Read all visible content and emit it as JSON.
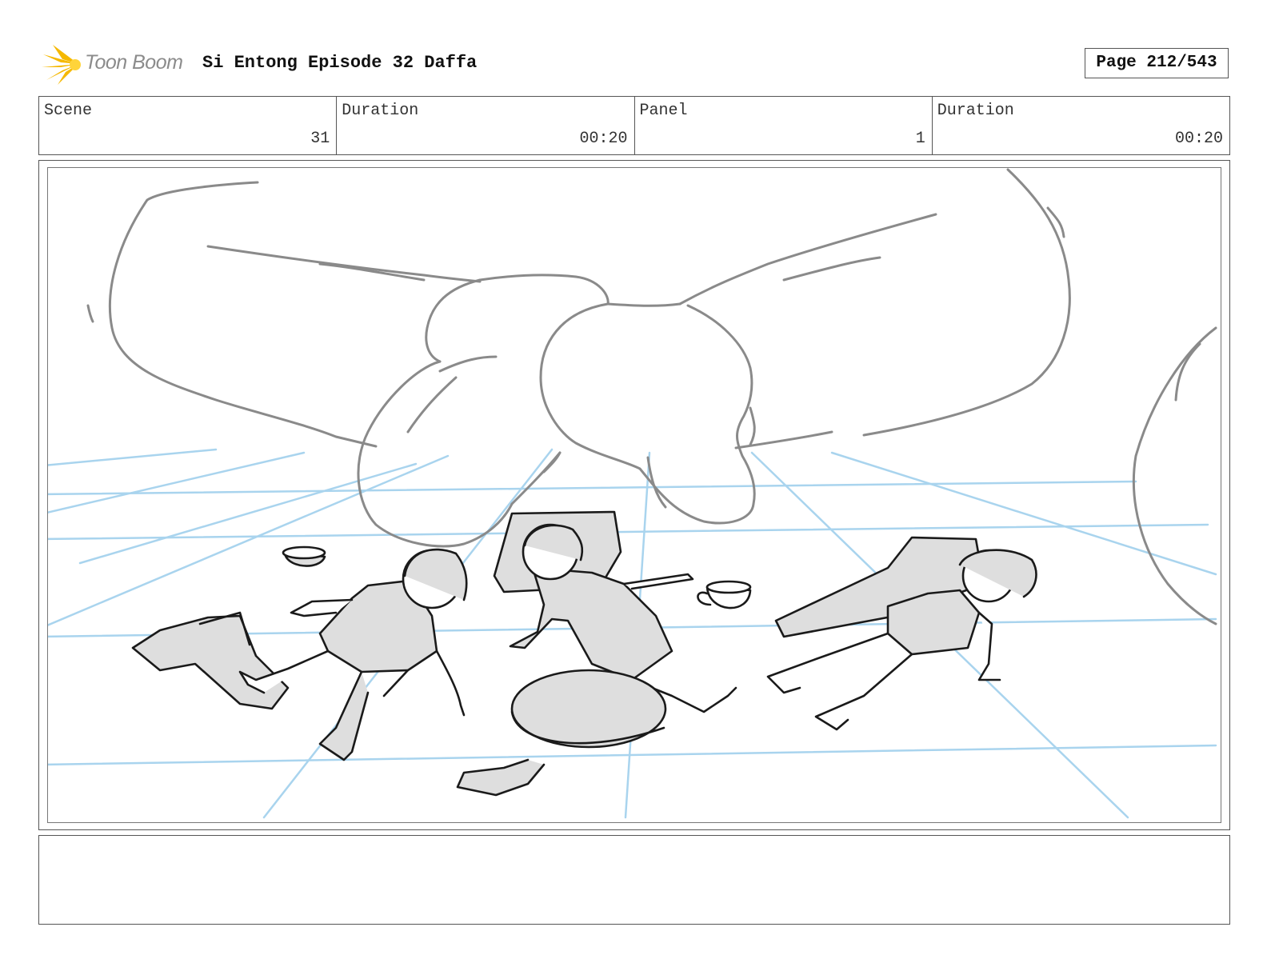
{
  "header": {
    "logo_text": "Toon Boom",
    "title": "Si Entong Episode 32 Daffa",
    "page_label": "Page 212/543"
  },
  "info": {
    "scene_label": "Scene",
    "scene_value": "31",
    "scene_duration_label": "Duration",
    "scene_duration_value": "00:20",
    "panel_label": "Panel",
    "panel_value": "1",
    "panel_duration_label": "Duration",
    "panel_duration_value": "00:20"
  },
  "notes": {
    "text": ""
  },
  "colors": {
    "guide_lines": "#a9d4ee",
    "giant_lines": "#8a8a8a",
    "character_fill": "#dedede",
    "ink": "#1a1a1a"
  }
}
